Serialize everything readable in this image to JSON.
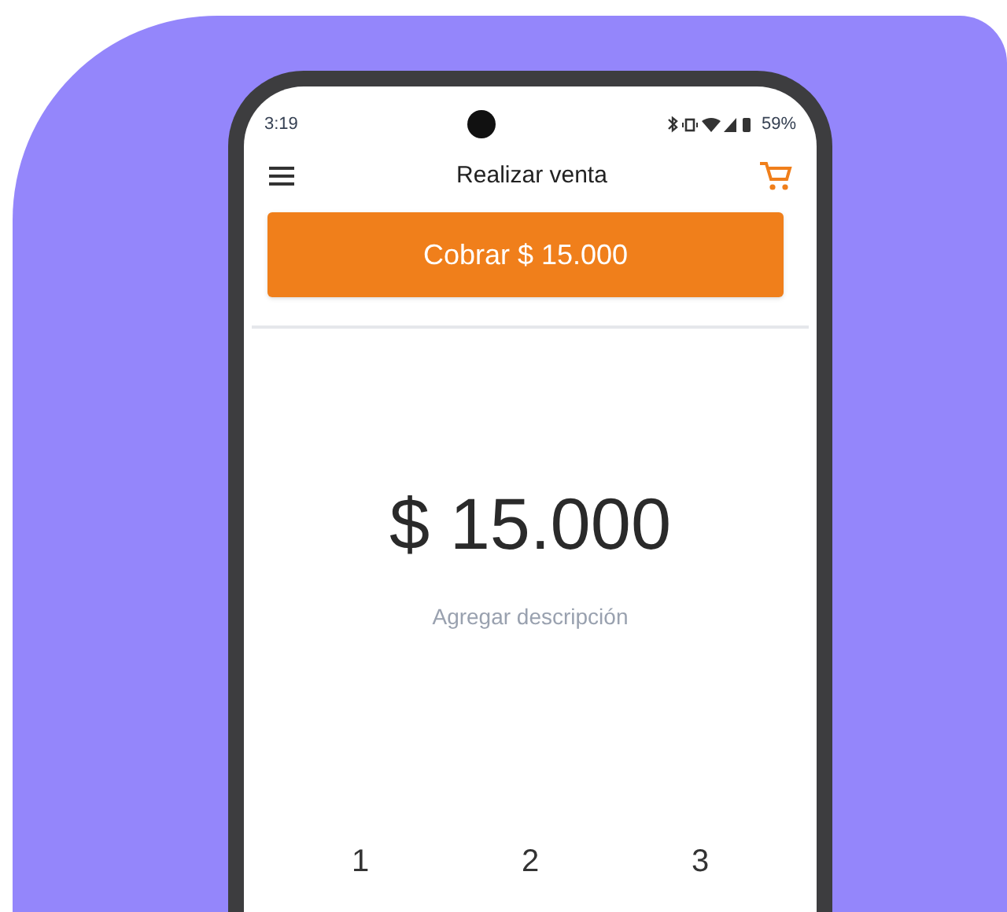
{
  "status_bar": {
    "time": "3:19",
    "battery": "59%"
  },
  "app_bar": {
    "title": "Realizar venta"
  },
  "charge_button": {
    "label": "Cobrar $ 15.000"
  },
  "amount": "$ 15.000",
  "description": {
    "placeholder": "Agregar descripción"
  },
  "keypad": [
    "1",
    "2",
    "3"
  ]
}
